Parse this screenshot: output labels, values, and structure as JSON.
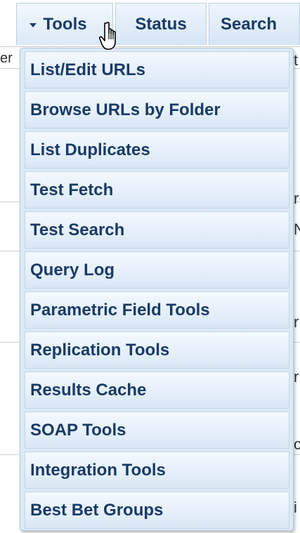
{
  "menubar": {
    "tabs": [
      {
        "label": "Tools",
        "has_caret": true
      },
      {
        "label": "Status"
      },
      {
        "label": "Search"
      }
    ]
  },
  "background": {
    "left_fragment": "er",
    "right_fragments": [
      "t",
      "r",
      "N",
      "r",
      "r",
      "c",
      "i"
    ]
  },
  "dropdown": {
    "items": [
      {
        "label": "List/Edit URLs"
      },
      {
        "label": "Browse URLs by Folder"
      },
      {
        "label": "List Duplicates"
      },
      {
        "label": "Test Fetch"
      },
      {
        "label": "Test Search"
      },
      {
        "label": "Query Log"
      },
      {
        "label": "Parametric Field Tools"
      },
      {
        "label": "Replication Tools"
      },
      {
        "label": "Results Cache"
      },
      {
        "label": "SOAP Tools"
      },
      {
        "label": "Integration Tools"
      },
      {
        "label": "Best Bet Groups"
      }
    ]
  },
  "colors": {
    "menu_text": "#1a3a66",
    "item_bg_top": "#f4f9fe",
    "item_bg_bottom": "#d9e7f5",
    "dropdown_bg": "#dce9f6",
    "border": "#c2d6ea"
  },
  "cursor": {
    "icon": "hand-pointer-icon"
  }
}
